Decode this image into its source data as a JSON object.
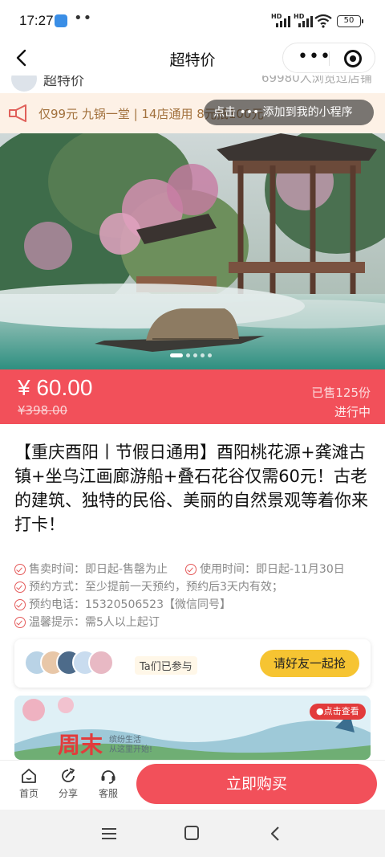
{
  "status_bar": {
    "time": "17:27",
    "dots": "••",
    "hd1": "HD",
    "hd2": "HD",
    "battery": "50"
  },
  "nav": {
    "title": "超特价",
    "more": "•••"
  },
  "store": {
    "name": "超特价",
    "views": "69980人浏览过店铺"
  },
  "notice": {
    "text": "仅99元      九锅一堂 | 14店通用 8元抵100元",
    "toast": "点击 ••• 添加到我的小程序"
  },
  "hero": {
    "slides_total": 5,
    "active_slide": 1
  },
  "price": {
    "current": "¥ 60.00",
    "original": "¥398.00",
    "sold": "已售125份",
    "status": "进行中"
  },
  "product": {
    "title": "【重庆酉阳丨节假日通用】酉阳桃花源+龚滩古镇+坐乌江画廊游船+叠石花谷仅需60元！古老的建筑、独特的民俗、美丽的自然景观等着你来打卡！"
  },
  "info": {
    "sale_time": "售卖时间：即日起-售罄为止",
    "use_time": "使用时间：即日起-11月30日",
    "booking_method": "预约方式：至少提前一天预约，预约后3天内有效；",
    "booking_phone": "预约电话：15320506523【微信同号】",
    "tips": "温馨提示：需5人以上起订"
  },
  "participants": {
    "joined_label": "Ta们已参与",
    "invite_button": "请好友一起抢"
  },
  "banner": {
    "headline": "周末",
    "sub_line1": "缤纷生活",
    "sub_line2": "从这里开始!",
    "badge": "●点击查看"
  },
  "action_bar": {
    "home": "首页",
    "share": "分享",
    "service": "客服",
    "buy": "立即购买"
  },
  "colors": {
    "accent": "#f2505a",
    "notice_bg": "#fdf1e6",
    "invite": "#f6c432"
  }
}
